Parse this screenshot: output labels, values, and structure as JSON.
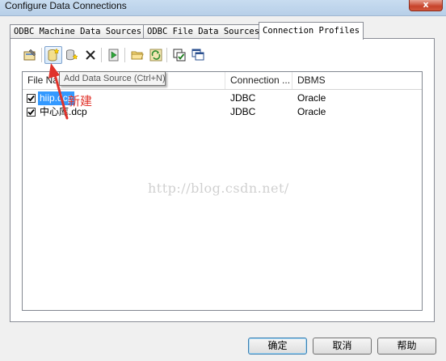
{
  "window": {
    "title": "Configure Data Connections",
    "close_glyph": "x"
  },
  "tabs": [
    {
      "label": "ODBC Machine Data Sources",
      "active": false
    },
    {
      "label": "ODBC File Data Sources",
      "active": false
    },
    {
      "label": "Connection Profiles",
      "active": true
    }
  ],
  "toolbar": {
    "items": [
      "properties-icon",
      "add-data-source-icon",
      "copy-icon",
      "delete-icon",
      "run-icon",
      "open-folder-icon",
      "refresh-icon",
      "check-all-icon",
      "windows-icon"
    ]
  },
  "tooltip": {
    "text": "Add Data Source (Ctrl+N)"
  },
  "list": {
    "columns": [
      "File Name",
      "Connection ...",
      "DBMS"
    ],
    "rows": [
      {
        "checked": true,
        "file": "hiip.dcp",
        "connection": "JDBC",
        "dbms": "Oracle",
        "selected": true
      },
      {
        "checked": true,
        "file": "中心库.dcp",
        "connection": "JDBC",
        "dbms": "Oracle",
        "selected": false
      }
    ]
  },
  "annotation": {
    "text": "新建",
    "color": "#e0332b"
  },
  "watermark": {
    "text": "http://blog.csdn.net/"
  },
  "buttons": {
    "ok": "确定",
    "cancel": "取消",
    "help": "帮助"
  },
  "colors": {
    "selection": "#3399ff",
    "annotation": "#e0332b"
  }
}
